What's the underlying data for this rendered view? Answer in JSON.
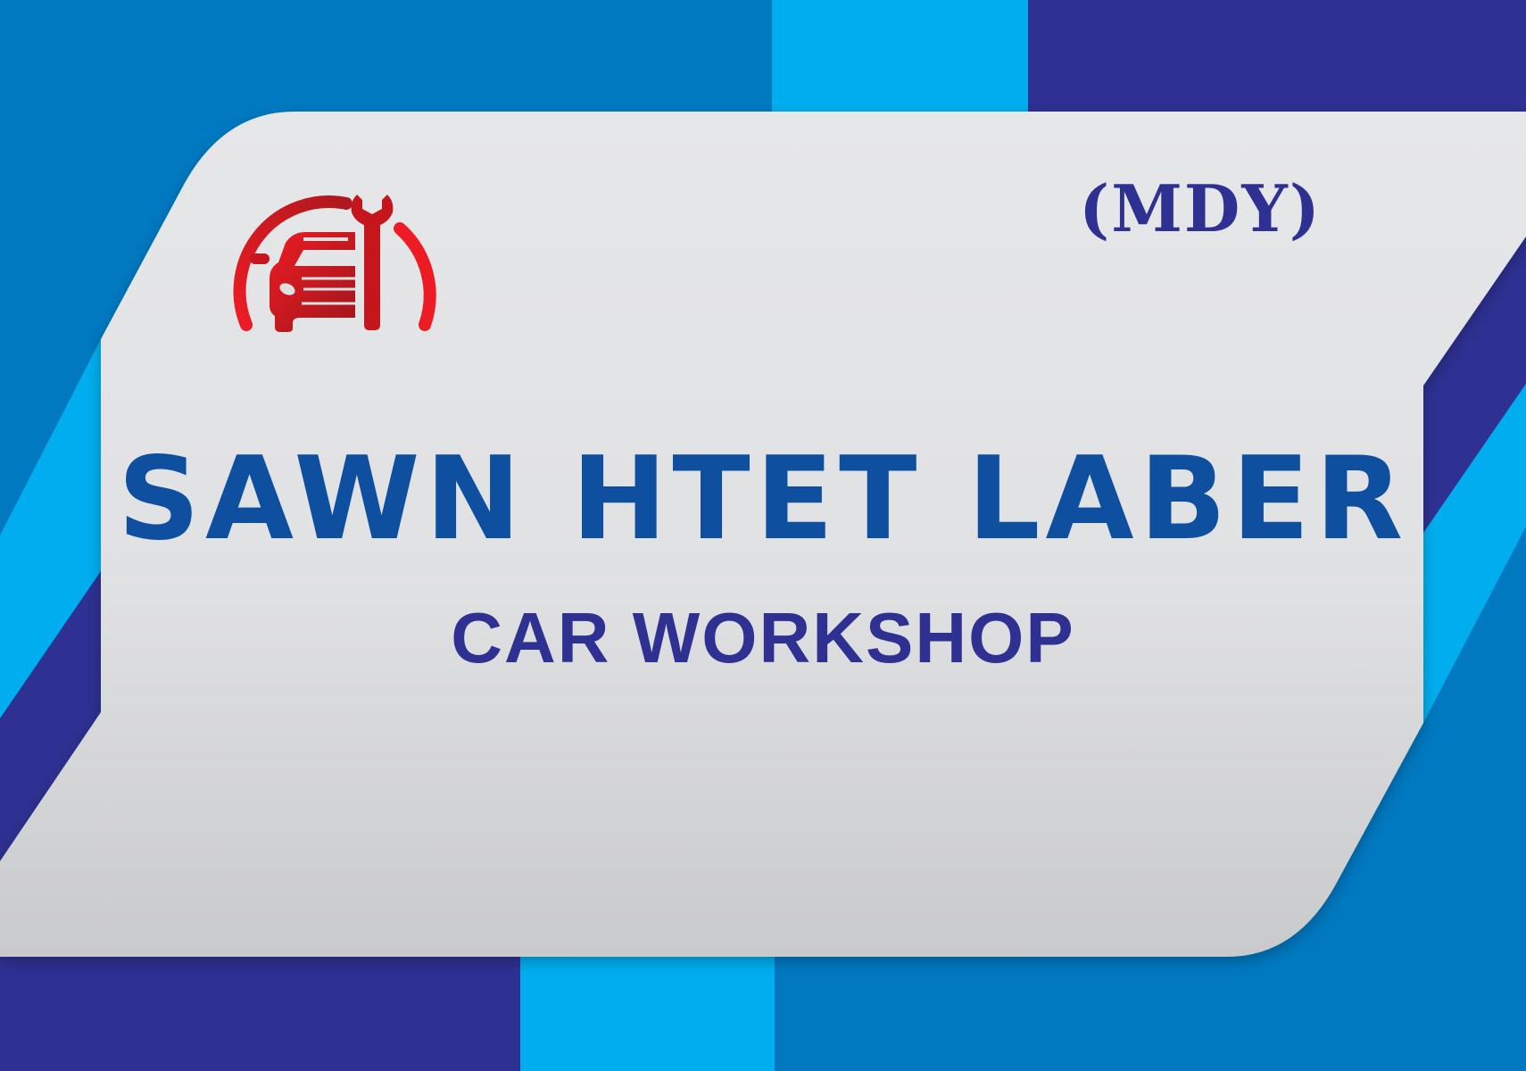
{
  "region_tag": "(MDY)",
  "brand": {
    "name": "SAWN HTET LABER",
    "subtitle": "CAR WORKSHOP"
  },
  "logo": {
    "icon": "car-repair-wrench-icon"
  },
  "colors": {
    "navy": "#2e3192",
    "mid_blue": "#0079c1",
    "light_blue": "#00aeef",
    "card_gray": "#dfe0e2",
    "brand_text": "#0e4fa0",
    "subtitle_text": "#2e3192",
    "logo_red": "#e5262b",
    "logo_dark_red": "#8a141c"
  }
}
